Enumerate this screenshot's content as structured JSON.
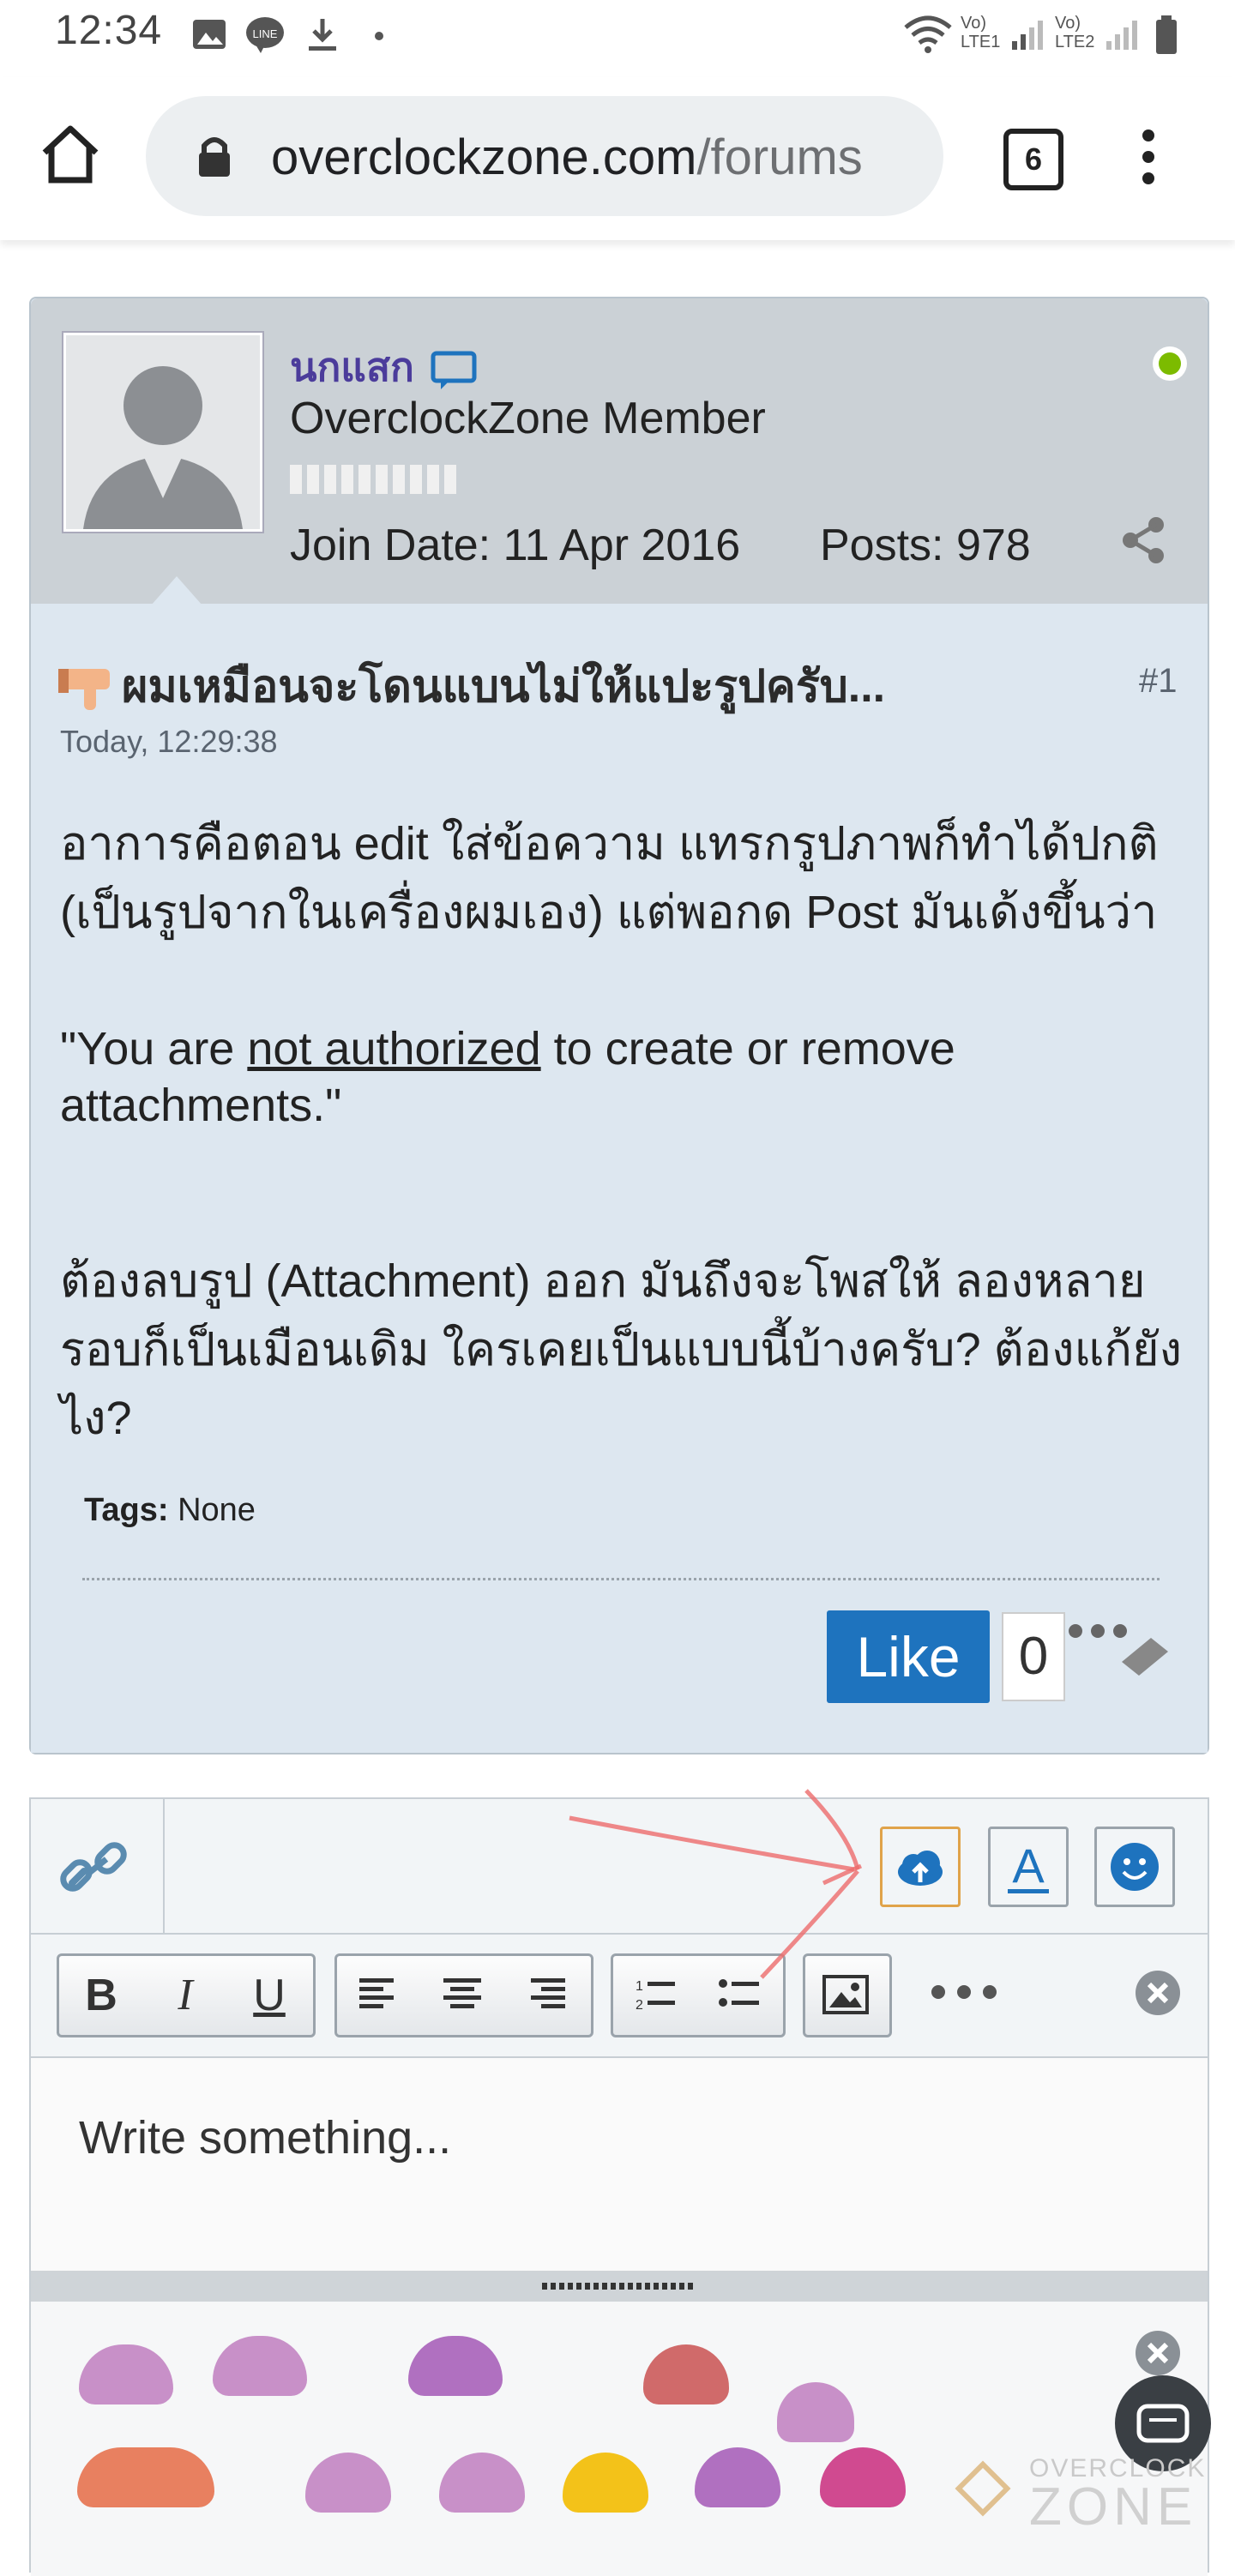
{
  "status_bar": {
    "time": "12:34",
    "sim1": "LTE1",
    "sim2": "LTE2",
    "volte": "Vo)"
  },
  "browser": {
    "url_host": "overclockzone.com",
    "url_path": "/forums",
    "tabs_count": "6"
  },
  "post": {
    "username": "นกแสก",
    "user_title": "OverclockZone Member",
    "join_date": "Join Date: 11 Apr 2016",
    "posts": "Posts: 978",
    "title": "ผมเหมือนจะโดนแบนไม่ให้แปะรูปครับ...",
    "number": "#1",
    "time": "Today, 12:29:38",
    "paragraph1": "อาการคือตอน edit ใส่ข้อความ แทรกรูปภาพก็ทำได้ปกติ (เป็นรูปจากในเครื่องผมเอง) แต่พอกด Post มันเด้งขึ้นว่า",
    "quote_prefix": "\"You are ",
    "quote_link": "not authorized",
    "quote_suffix": " to create or remove attachments.\"",
    "paragraph3": "ต้องลบรูป (Attachment) ออก มันถึงจะโพสให้ ลองหลายรอบก็เป็นเมือนเดิม ใครเคยเป็นแบบนี้บ้างครับ? ต้องแก้ยังไง?",
    "tags_label": "Tags:",
    "tags_value": "None",
    "like_label": "Like",
    "like_count": "0"
  },
  "editor": {
    "bold": "B",
    "italic": "I",
    "underline": "U",
    "placeholder": "Write something..."
  },
  "watermark": {
    "line1": "OVERCLOCK",
    "line2": "ZONE"
  },
  "colors": {
    "like_blue": "#1e73be",
    "online_green": "#7cbb00",
    "username_purple": "#4b3c9b",
    "upload_highlight": "#e0a34a"
  }
}
